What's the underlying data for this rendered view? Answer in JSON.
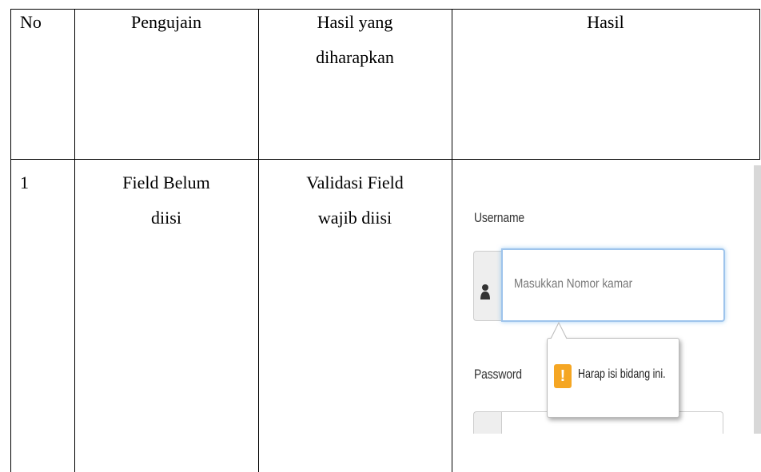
{
  "table": {
    "headers": {
      "no": "No",
      "pengujian": "Pengujain",
      "hasil_diharapkan": "Hasil yang\ndiharapkan",
      "hasil": "Hasil"
    },
    "rows": [
      {
        "no": "1",
        "pengujian": "Field Belum\ndiisi",
        "hasil_diharapkan": "Validasi Field\nwajib diisi"
      }
    ]
  },
  "screenshot": {
    "username_label": "Username",
    "username_placeholder": "Masukkan Nomor kamar",
    "password_label": "Password",
    "tooltip_icon": "!",
    "tooltip_text": "Harap isi bidang ini.",
    "icons": {
      "user": "user-icon",
      "warning": "warning-icon"
    },
    "colors": {
      "focus_border": "#9ec4ec",
      "warning": "#f5a623"
    }
  }
}
